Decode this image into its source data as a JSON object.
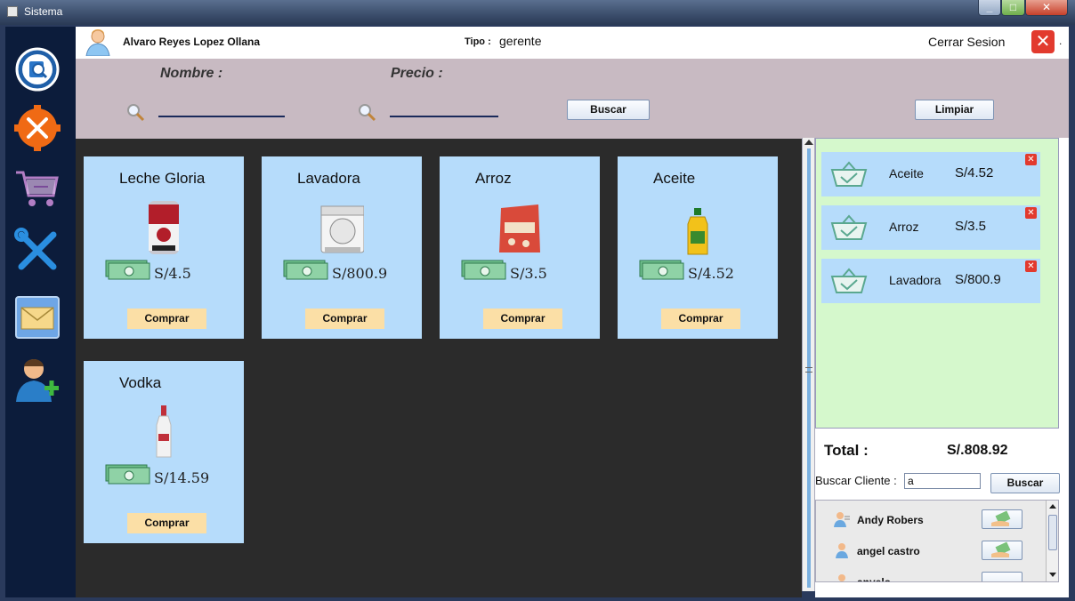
{
  "window": {
    "title": "Sistema",
    "minimize": "_",
    "maximize": "□",
    "close": "✕"
  },
  "header": {
    "user_name": "Alvaro Reyes Lopez Ollana",
    "tipo_label": "Tipo :",
    "tipo_value": "gerente",
    "logout_label": "Cerrar Sesion",
    "logout_icon": "✕",
    "trailing_dot": "."
  },
  "filters": {
    "nombre_label": "Nombre :",
    "precio_label": "Precio :",
    "nombre_value": "",
    "precio_value": "",
    "search_button": "Buscar",
    "clear_button": "Limpiar"
  },
  "nav": {
    "items": [
      "search-document-icon",
      "tools-settings-icon",
      "shopping-cart-icon",
      "wrench-screwdriver-icon",
      "mail-envelope-icon",
      "add-user-icon"
    ]
  },
  "products": [
    {
      "name": "Leche Gloria",
      "price": "S/4.5",
      "buy": "Comprar",
      "image": "milk-can"
    },
    {
      "name": "Lavadora",
      "price": "S/800.9",
      "buy": "Comprar",
      "image": "washing-machine"
    },
    {
      "name": "Arroz",
      "price": "S/3.5",
      "buy": "Comprar",
      "image": "rice-bag"
    },
    {
      "name": "Aceite",
      "price": "S/4.52",
      "buy": "Comprar",
      "image": "oil-bottle"
    },
    {
      "name": "Vodka",
      "price": "S/14.59",
      "buy": "Comprar",
      "image": "vodka-bottle"
    }
  ],
  "cart": {
    "items": [
      {
        "name": "Aceite",
        "price": "S/4.52",
        "remove": "✕"
      },
      {
        "name": "Arroz",
        "price": "S/3.5",
        "remove": "✕"
      },
      {
        "name": "Lavadora",
        "price": "S/800.9",
        "remove": "✕"
      }
    ],
    "total_label": "Total :",
    "total_value": "S/.808.92"
  },
  "client_search": {
    "label": "Buscar Cliente :",
    "value": "a",
    "button": "Buscar"
  },
  "clients": [
    {
      "name": "Andy Robers"
    },
    {
      "name": "angel castro"
    },
    {
      "name": "anyelo"
    }
  ],
  "colors": {
    "nav_bg": "#0c1c3b",
    "filter_bg": "#c8bac2",
    "card_bg": "#b6dcfb",
    "buy_btn": "#fbdfa6",
    "cart_bg": "#d5f8cc",
    "products_bg": "#2b2b2b"
  }
}
